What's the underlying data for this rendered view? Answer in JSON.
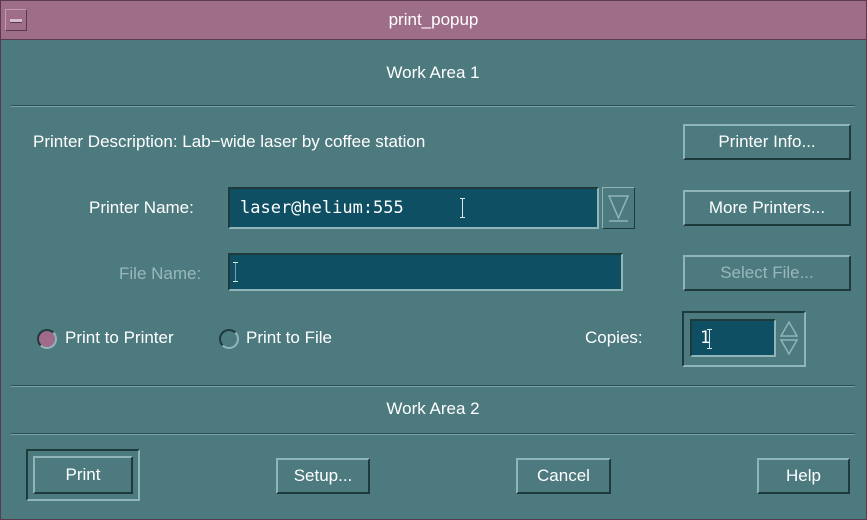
{
  "window": {
    "title": "print_popup",
    "menu_icon": "window-menu-icon"
  },
  "work_area_1": "Work Area 1",
  "work_area_2": "Work Area 2",
  "printer_description": {
    "label": "Printer Description:",
    "value": "Lab−wide laser by coffee station"
  },
  "printer_name": {
    "label": "Printer Name:",
    "value": "laser@helium:555",
    "dropdown_icon": "chevron-down-icon"
  },
  "file_name": {
    "label": "File Name:",
    "value": "",
    "enabled": false
  },
  "buttons": {
    "printer_info": "Printer Info...",
    "more_printers": "More Printers...",
    "select_file": "Select File...",
    "print": "Print",
    "setup": "Setup...",
    "cancel": "Cancel",
    "help": "Help"
  },
  "destination": {
    "options": [
      "Print to Printer",
      "Print to File"
    ],
    "selected": "Print to Printer"
  },
  "copies": {
    "label": "Copies:",
    "value": "1",
    "spinner_icon": "spinner-arrows-icon"
  },
  "colors": {
    "window_bg": "#4c7a7e",
    "title_bar": "#9e6e88",
    "field_bg": "#0e4f63",
    "radio_selected": "#a06a8a"
  }
}
